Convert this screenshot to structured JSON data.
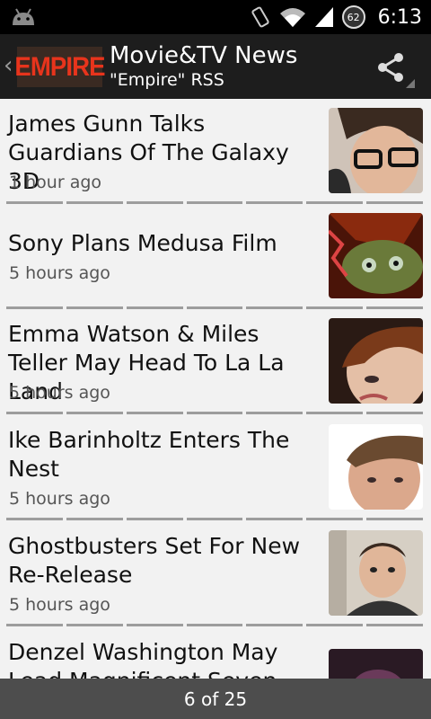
{
  "status_bar": {
    "time": "6:13",
    "battery_level": "62",
    "icons": [
      "android-icon",
      "rotate-icon",
      "wifi-icon",
      "signal-icon",
      "battery-icon"
    ]
  },
  "action_bar": {
    "logo_text": "EMPIRE",
    "title": "Movie&TV News",
    "subtitle": "\"Empire\" RSS",
    "share_icon": "share-icon"
  },
  "articles": [
    {
      "title": "James Gunn Talks Guardians Of The Galaxy 3D",
      "time": "1 hour ago"
    },
    {
      "title": "Sony Plans Medusa Film",
      "time": "5 hours ago"
    },
    {
      "title": "Emma Watson & Miles Teller May Head To La La Land",
      "time": "5 hours ago"
    },
    {
      "title": "Ike Barinholtz Enters The Nest",
      "time": "5 hours ago"
    },
    {
      "title": "Ghostbusters Set For New Re-Release",
      "time": "5 hours ago"
    },
    {
      "title": "Denzel Washington May Lead Magnificent Seven",
      "time": ""
    }
  ],
  "footer": {
    "page_indicator": "6 of 25"
  },
  "colors": {
    "status_bar_bg": "#000000",
    "action_bar_bg": "#1d1d1d",
    "logo_red": "#e8341c",
    "list_bg": "#f2f2f2",
    "footer_bg": "#4d4d4d"
  }
}
